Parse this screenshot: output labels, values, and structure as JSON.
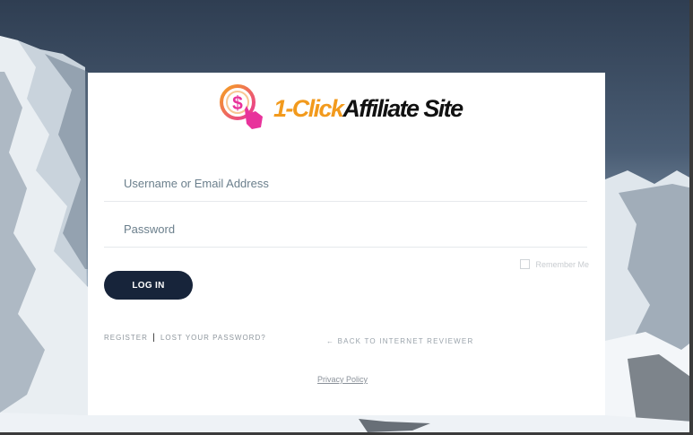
{
  "logo": {
    "text_orange": "1-Click",
    "text_black": "Affiliate Site",
    "icon": "dollar-click-icon"
  },
  "form": {
    "username_placeholder": "Username or Email Address",
    "password_placeholder": "Password",
    "remember_label": "Remember Me",
    "remember_checked": false,
    "login_label": "LOG IN"
  },
  "links": {
    "register": "REGISTER",
    "separator": "|",
    "lost_password": "LOST YOUR PASSWORD?",
    "back": "← BACK TO INTERNET REVIEWER",
    "privacy": "Privacy Policy"
  },
  "colors": {
    "accent_orange": "#f29a1d",
    "accent_magenta": "#e8339b",
    "button_bg": "#17243a"
  }
}
